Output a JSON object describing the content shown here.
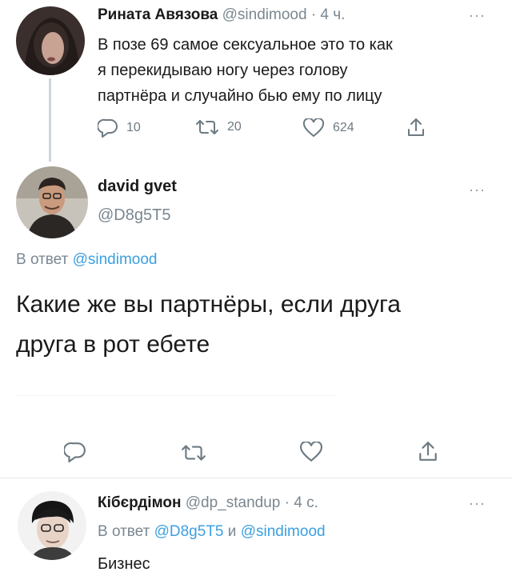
{
  "tweet1": {
    "name": "Рината Авязова",
    "handle": "@sindimood",
    "time": "· 4 ч.",
    "text_lines": [
      "В позе 69 самое сексуальное это то как",
      "я перекидываю ногу через голову",
      "партнёра и случайно бью ему по лицу"
    ],
    "replies": "10",
    "retweets": "20",
    "likes": "624"
  },
  "tweet2": {
    "name": "david gvet",
    "handle": "@D8g5T5",
    "reply_to_prefix": "В ответ",
    "reply_to_handle": "@sindimood",
    "text_lines": [
      "Какие же вы партнёры, если друга",
      "друга в рот ебете"
    ]
  },
  "tweet3": {
    "name": "Кібєрдімон",
    "handle": "@dp_standup",
    "time": "· 4 с.",
    "reply_to_prefix": "В ответ",
    "reply_to_handle1": "@D8g5T5",
    "reply_to_joiner": "и",
    "reply_to_handle2": "@sindimood",
    "text": "Бизнес"
  },
  "icons": {
    "reply": "reply-icon",
    "retweet": "retweet-icon",
    "like": "heart-icon",
    "share": "share-icon",
    "more": "more-icon"
  },
  "more_glyph": "···",
  "colors": {
    "link": "#3b9fe0",
    "muted": "#7a8790",
    "icon": "#6d7a82"
  }
}
